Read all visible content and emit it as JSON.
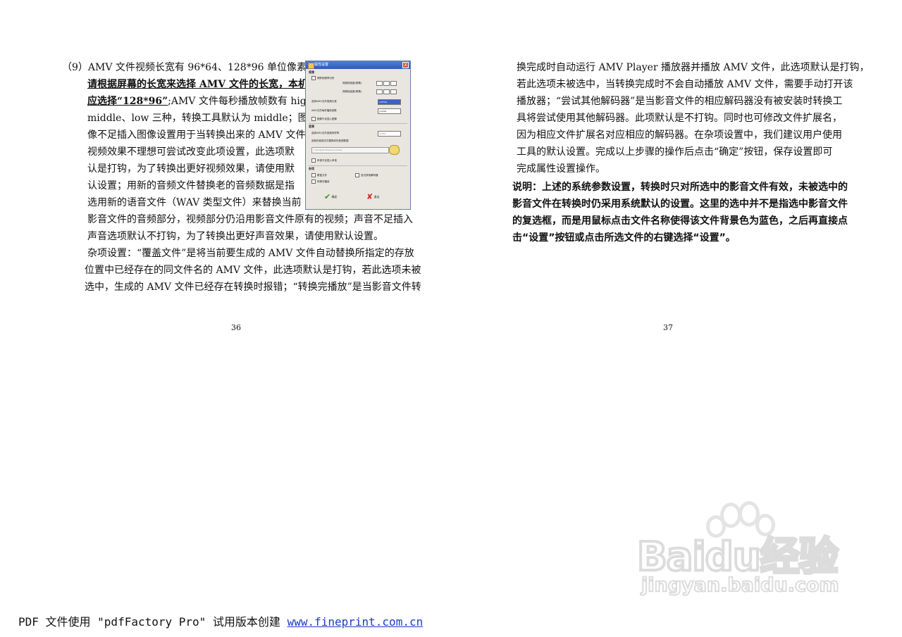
{
  "left_page": {
    "lines": [
      "（9）AMV 文件视频长宽有 96*64、128*96 单位像素点，",
      "",
      "middle、low 三种，转换工具默认为 middle；图",
      "像不足插入图像设置用于当转换出来的 AMV 文件",
      "视频效果不理想可尝试改变此项设置，此选项默",
      "认是打钩，为了转换出更好视频效果，请使用默",
      "认设置；用新的音频文件替换老的音频数据是指",
      "选用新的语音文件（WAV 类型文件）来替换当前",
      "影音文件的音频部分，视频部分仍沿用影音文件原有的视频；声音不足插入",
      "声音选项默认不打钩，为了转换出更好声音效果，请使用默认设置。",
      "杂项设置：“覆盖文件”是将当前要生成的 AMV 文件自动替换所指定的存放",
      "位置中已经存在的同文件名的 AMV 文件，此选项默认是打钩，若此选项未被",
      "选中，生成的 AMV 文件已经存在转换时报错；“转换完播放”是当影音文件转"
    ],
    "line2_underlined": "请根据屏幕的长宽来选择 AMV 文件的长宽，本机",
    "line3_underlined": "应选择“128*96”",
    "line3_rest": ";AMV 文件每秒播放帧数有 high、",
    "page_number": "36"
  },
  "dialog": {
    "title": "属性设置",
    "close": "X",
    "video_group": "视频",
    "video_opt1": "捕获帧频率分析",
    "size_label1": "视频帧宽度(像素)",
    "size_label2": "视频帧高度(像素)",
    "size_select_label": "选择AMV文件视频长宽",
    "size_select_value": "128*96",
    "fps_label": "AMV文件每秒播放帧数",
    "fps_value": "middle",
    "video_opt2": "图像不足插入图像",
    "audio_group": "音频",
    "audio_rate_label": "选择AMV文件音频采样率",
    "audio_rate_value": "22050",
    "audio_replace_label": "用新的音频文件替换老的音频数据",
    "audio_path": "c:\\program files\\sound.wav",
    "audio_opt": "声音不足插入声音",
    "misc_group": "杂项",
    "misc_opt1": "覆盖文件",
    "misc_opt2": "尝试其他解码器",
    "misc_opt3": "转换完播放",
    "ok_label": "确定",
    "cancel_label": "退出"
  },
  "right_page": {
    "lines": [
      "换完成时自动运行 AMV Player 播放器并播放 AMV 文件，此选项默认是打钩，",
      "若此选项未被选中，当转换完成时不会自动播放 AMV 文件，需要手动打开该",
      "播放器；“尝试其他解码器”是当影音文件的相应解码器没有被安装时转换工",
      "具将尝试使用其他解码器。此项默认是不打钩。同时也可修改文件扩展名，",
      "因为相应文件扩展名对应相应的解码器。在杂项设置中，我们建议用户使用",
      "工具的默认设置。完成以上步骤的操作后点击“确定”按钮，保存设置即可",
      "完成属性设置操作。"
    ],
    "note_lines": [
      "说明：上述的系统参数设置，转换时只对所选中的影音文件有效，未被选中的",
      "影音文件在转换时仍采用系统默认的设置。这里的选中并不是指选中影音文件",
      "的复选框，而是用鼠标点击文件名称使得该文件背景色为蓝色，之后再直接点",
      "击“设置”按钮或点击所选文件的右键选择“设置”。"
    ],
    "page_number": "37"
  },
  "watermark": {
    "main": "Baidu经验",
    "sub": "jingyan.baidu.com"
  },
  "footer": {
    "text": "PDF 文件使用 \"pdfFactory Pro\" 试用版本创建 ",
    "link": "www.fineprint.com.cn"
  }
}
